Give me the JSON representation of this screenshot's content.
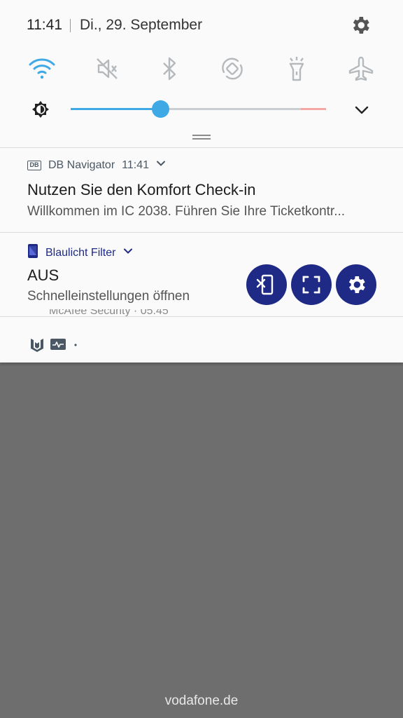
{
  "status_bar": {
    "time": "11:41",
    "date": "Di., 29. September",
    "settings_icon": "gear-icon"
  },
  "quick_settings": [
    {
      "name": "wifi",
      "icon": "wifi-icon",
      "active": true
    },
    {
      "name": "sound",
      "icon": "mute-icon",
      "active": false
    },
    {
      "name": "bluetooth",
      "icon": "bluetooth-icon",
      "active": false
    },
    {
      "name": "auto-rotate",
      "icon": "rotate-icon",
      "active": false
    },
    {
      "name": "flashlight",
      "icon": "flashlight-icon",
      "active": false
    },
    {
      "name": "airplane",
      "icon": "airplane-icon",
      "active": false
    }
  ],
  "brightness": {
    "level": 0.35,
    "accent": "#3fa9e6"
  },
  "notifications": [
    {
      "app": "DB Navigator",
      "app_badge": "DB",
      "time": "11:41",
      "title": "Nutzen Sie den Komfort Check-in",
      "text": "Willkommen im IC 2038. Führen Sie Ihre Ticketkontr..."
    },
    {
      "app": "Blaulicht Filter",
      "title": "AUS",
      "text": "Schnelleinstellungen öffnen",
      "accent": "#1f2a86"
    }
  ],
  "peek": {
    "text": "McAfee Security · 05:45"
  },
  "carrier": "vodafone.de"
}
